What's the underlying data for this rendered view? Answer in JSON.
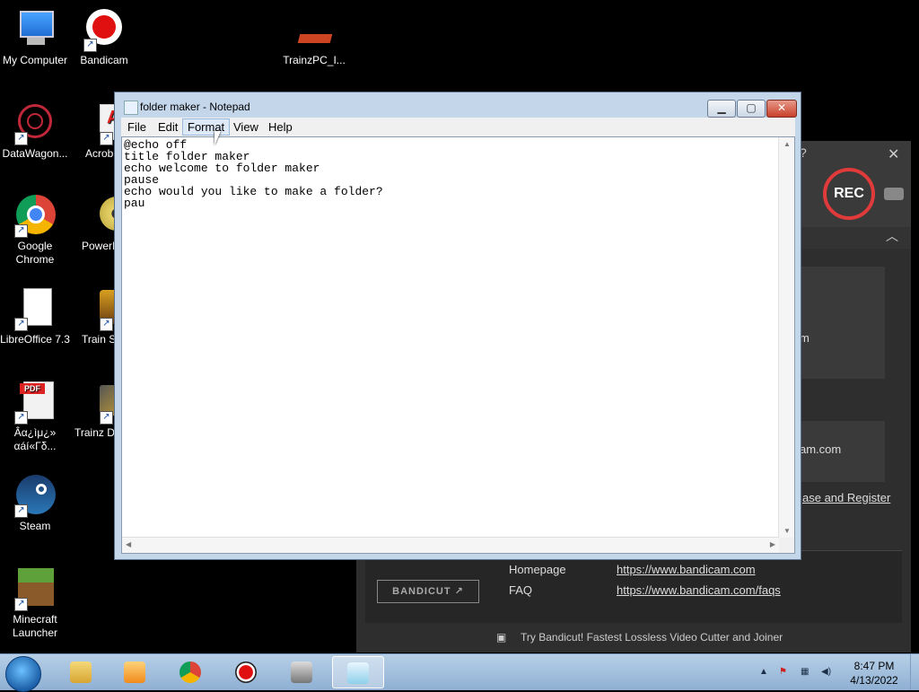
{
  "desktop": {
    "icons": [
      {
        "label": "My Computer"
      },
      {
        "label": "Bandicam"
      },
      {
        "label": "TrainzPC_I..."
      },
      {
        "label": "DataWagon..."
      },
      {
        "label": "Acrob Reader"
      },
      {
        "label": "Google Chrome"
      },
      {
        "label": "PowerI"
      },
      {
        "label": "LibreOffice 7.3"
      },
      {
        "label": "Train Simula"
      },
      {
        "label": "Âα¿ìμ¿» αáí«Γδ..."
      },
      {
        "label": "Trainz D"
      },
      {
        "label": "Steam"
      },
      {
        "label": "Minecraft Launcher"
      }
    ]
  },
  "notepad": {
    "title": "folder maker - Notepad",
    "menu": [
      "File",
      "Edit",
      "Format",
      "View",
      "Help"
    ],
    "active_menu": "Format",
    "content": "@echo off\ntitle folder maker\necho welcome to folder maker\npause\necho would you like to make a folder?\npau"
  },
  "bandicam": {
    "rec_label": "REC",
    "text1": "m",
    "text2": "am.com",
    "register": "ase and Register",
    "homepage_label": "Homepage",
    "homepage_url": "https://www.bandicam.com",
    "faq_label": "FAQ",
    "faq_url": "https://www.bandicam.com/faqs",
    "bandicut_label": "BANDICUT ↗",
    "footer": "Try Bandicut! Fastest Lossless Video Cutter and Joiner"
  },
  "taskbar": {
    "time": "8:47 PM",
    "date": "4/13/2022"
  },
  "colors": {
    "desktop_bg": "#000000",
    "bandicam_rec": "#e03a3a",
    "taskbar": "#9fbfe0"
  }
}
